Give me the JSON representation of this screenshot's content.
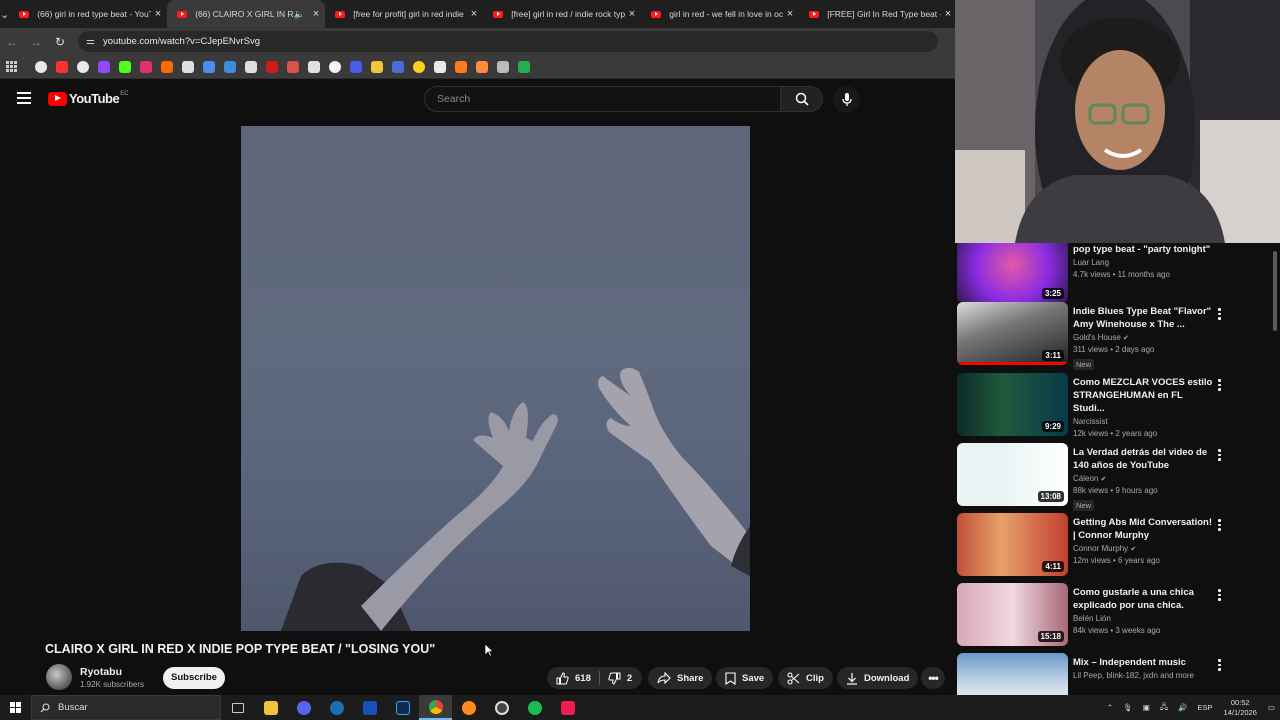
{
  "browser": {
    "tabs": [
      {
        "title": "(66) girl in red type beat - YouTube",
        "active": false,
        "audio": false
      },
      {
        "title": "(66) CLAIRO X GIRL IN RED",
        "active": true,
        "audio": true
      },
      {
        "title": "[free for profit] girl in red indie",
        "active": false,
        "audio": false
      },
      {
        "title": "[free] girl in red / indie rock typ",
        "active": false,
        "audio": false
      },
      {
        "title": "girl in red - we fell in love in oc",
        "active": false,
        "audio": false
      },
      {
        "title": "[FREE] Girl In Red Type beat - B",
        "active": false,
        "audio": false
      }
    ],
    "url": "youtube.com/watch?v=CJepENvrSvg",
    "bookmark_colors": [
      "#e8e8e8",
      "#ff3030",
      "#eaeaea",
      "#9146ff",
      "#53fc18",
      "#e1306c",
      "#ff6a00",
      "#e0e0e0",
      "#4c8bf5",
      "#3c8dde",
      "#e0e0e0",
      "#d11a1a",
      "#d9534f",
      "#e0e0e0",
      "#f4f4f4",
      "#4a5aef",
      "#f0c43c",
      "#4d6bd8",
      "#f7d21a",
      "#e9e9e9",
      "#ff7a1a",
      "#ff8c3a",
      "#bbbbbb",
      "#22b14c"
    ]
  },
  "youtube": {
    "logo_text": "YouTube",
    "country_code": "EC",
    "search_placeholder": "Search",
    "video_title": "CLAIRO X GIRL IN RED X INDIE POP TYPE BEAT / \"LOSING YOU\"",
    "channel_name": "Ryotabu",
    "subscribers": "1.92K subscribers",
    "subscribe_label": "Subscribe",
    "likes": "618",
    "dislikes": "2",
    "share_label": "Share",
    "save_label": "Save",
    "clip_label": "Clip",
    "download_label": "Download"
  },
  "recommendations": [
    {
      "title": "pop type beat - \"party tonight\"",
      "channel": "Luar Lang",
      "verified": false,
      "views": "4.7k views • 11 months ago",
      "duration": "3:25",
      "new": false,
      "kebab": false,
      "progress": 0
    },
    {
      "title": "Indie Blues Type Beat \"Flavor\" Amy Winehouse x The ...",
      "channel": "Gold's House",
      "verified": true,
      "views": "311 views • 2 days ago",
      "duration": "3:11",
      "new": true,
      "kebab": true,
      "progress": 1
    },
    {
      "title": "Como MEZCLAR VOCES estilo STRANGEHUMAN en FL Studi...",
      "channel": "Narcissist",
      "verified": false,
      "views": "12k views • 2 years ago",
      "duration": "9:29",
      "new": false,
      "kebab": true,
      "progress": 0
    },
    {
      "title": "La Verdad detrás del video de 140 años de YouTube",
      "channel": "Cáleon",
      "verified": true,
      "views": "88k views • 9 hours ago",
      "duration": "13:08",
      "new": true,
      "kebab": true,
      "progress": 0
    },
    {
      "title": "Getting Abs Mid Conversation! | Connor Murphy",
      "channel": "Connor Murphy",
      "verified": true,
      "views": "12m views • 6 years ago",
      "duration": "4:11",
      "new": false,
      "kebab": true,
      "progress": 0
    },
    {
      "title": "Como gustarle a una chica explicado por una chica.",
      "channel": "Belén Lión",
      "verified": false,
      "views": "84k views • 3 weeks ago",
      "duration": "15:18",
      "new": false,
      "kebab": true,
      "progress": 0
    },
    {
      "title": "Mix – Independent music",
      "channel": "Lil Peep, blink-182, jxdn and more",
      "verified": false,
      "views": "",
      "duration": "",
      "new": false,
      "kebab": true,
      "progress": 0
    }
  ],
  "new_badge": "New",
  "taskbar": {
    "search_placeholder": "Buscar",
    "language": "ESP",
    "time": "00:52",
    "date": "14/1/2026"
  }
}
